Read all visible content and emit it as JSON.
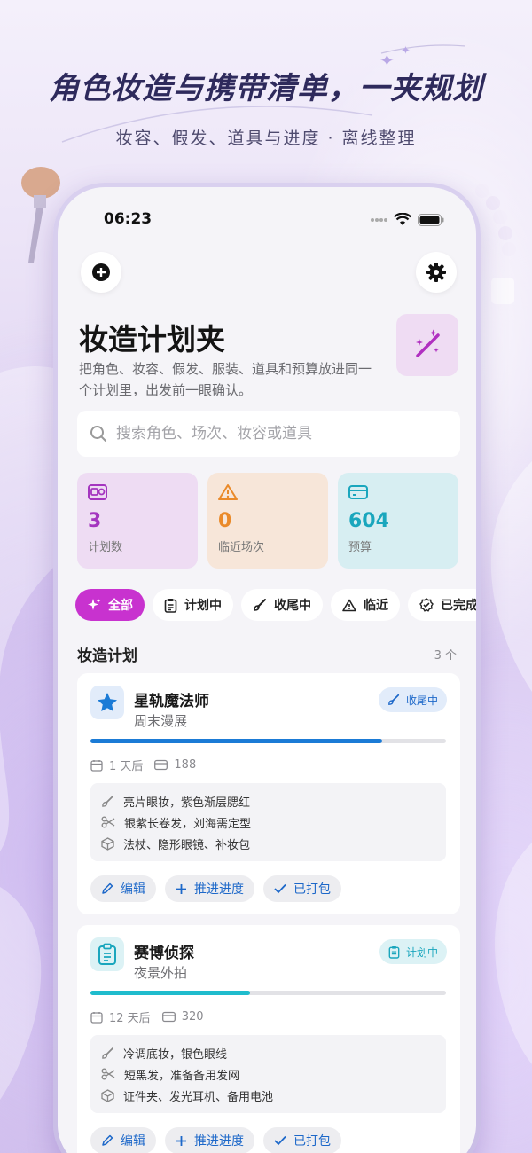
{
  "promo": {
    "title": "角色妆造与携带清单，一夹规划",
    "subtitle": "妆容、假发、道具与进度 · 离线整理"
  },
  "status_bar": {
    "time": "06:23"
  },
  "header": {
    "title": "妆造计划夹",
    "description": "把角色、妆容、假发、服装、道具和预算放进同一个计划里，出发前一眼确认。"
  },
  "search": {
    "placeholder": "搜索角色、场次、妆容或道具",
    "value": ""
  },
  "stats": [
    {
      "value": "3",
      "label": "计划数",
      "color": "#a435bf",
      "bg": "#eedcf3"
    },
    {
      "value": "0",
      "label": "临近场次",
      "color": "#ea8a2a",
      "bg": "#f7e6d9"
    },
    {
      "value": "604",
      "label": "预算",
      "color": "#1aa6bd",
      "bg": "#d7eef2"
    }
  ],
  "filters": [
    {
      "label": "全部",
      "icon": "sparkle-icon",
      "active": true
    },
    {
      "label": "计划中",
      "icon": "clipboard-icon",
      "active": false
    },
    {
      "label": "收尾中",
      "icon": "brush-icon",
      "active": false
    },
    {
      "label": "临近",
      "icon": "warning-icon",
      "active": false
    },
    {
      "label": "已完成",
      "icon": "badge-check-icon",
      "active": false
    }
  ],
  "section": {
    "title": "妆造计划",
    "count": "3 个"
  },
  "plans": [
    {
      "name": "星轨魔法师",
      "event": "周末漫展",
      "icon": "star-icon",
      "status": "收尾中",
      "status_color": "#1d68c9",
      "status_bg": "#e2ecfa",
      "progress": 0.82,
      "progress_color": "#1b7bd6",
      "days": "1 天后",
      "budget": "188",
      "makeup": "亮片眼妆，紫色渐层腮红",
      "wig": "银紫长卷发，刘海需定型",
      "props": "法杖、隐形眼镜、补妆包"
    },
    {
      "name": "赛博侦探",
      "event": "夜景外拍",
      "icon": "clipboard-icon",
      "status": "计划中",
      "status_color": "#1aa6bd",
      "status_bg": "#dcf2f5",
      "progress": 0.45,
      "progress_color": "#1fbccd",
      "days": "12 天后",
      "budget": "320",
      "makeup": "冷调底妆，银色眼线",
      "wig": "短黑发，准备备用发网",
      "props": "证件夹、发光耳机、备用电池"
    }
  ],
  "actions": {
    "edit": "编辑",
    "advance": "推进进度",
    "packed": "已打包"
  }
}
